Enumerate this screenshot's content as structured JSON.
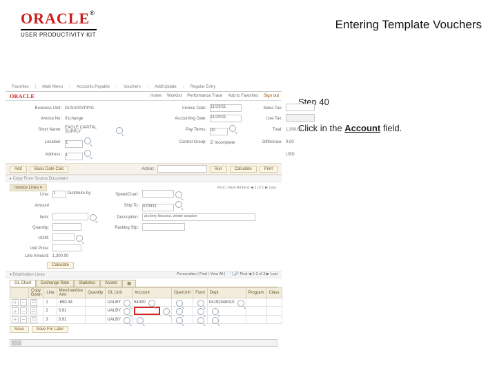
{
  "logo": {
    "brand": "ORACLE",
    "reg": "®",
    "sub": "USER PRODUCTIVITY KIT"
  },
  "doc_title": "Entering Template Vouchers",
  "step": {
    "label": "Step 40",
    "pre": "Click in the ",
    "field": "Account",
    "post": " field."
  },
  "shot": {
    "breadcrumb": {
      "i0": "Favorites",
      "i1": "Main Menu",
      "i2": "Accounts Payable",
      "i3": "Vouchers",
      "i4": "Add/Update",
      "i5": "Regular Entry"
    },
    "toplinks": {
      "home": "Home",
      "worklist": "Worklist",
      "pt": "Performance Trace",
      "atf": "Add to Favorites",
      "signout": "Sign out"
    },
    "brand_small": "ORACLE",
    "hdr": {
      "l_unit": "Business Unit:",
      "v_unit": "DUSAPAYPP01",
      "l_invno": "Invoice No:",
      "v_invno": "01change",
      "l_invdt": "Invoice Date:",
      "v_invdt": "11/29/11",
      "l_ctrl": "Control Group:",
      "l_acct": "Accounting Date:",
      "v_acct": "11/29/11",
      "l_short": "Short Name:",
      "v_short": "EAGLE CAPITAL SUPPLY",
      "l_loc": "Location:",
      "v_loc": "1",
      "l_addr": "Address:",
      "v_addr": "1",
      "l_incmp_chk": "Incomplete",
      "incmp_checked": "☑",
      "l_pay": "Pay Terms:",
      "v_pay": "00",
      "l_sales": "Sales Tax:",
      "l_use": "Use Tax:",
      "l_total": "Total:",
      "v_total": "1,300.00",
      "l_diff": "Difference:",
      "v_diff": "0.00",
      "v_curr": "USD"
    },
    "btns": {
      "add": "Add",
      "basis": "Basis Date Calc",
      "action_lbl": "Action:",
      "run": "Run",
      "calc": "Calculate",
      "prn": "Print"
    },
    "chev": "▸  Copy From Source Document",
    "inv_tab": "Invoice Lines ▾",
    "pcright": "Find | View All    First ◀ 1 of 1 ▶ Last",
    "inv": {
      "l_line": "Line:",
      "v_line": "1",
      "l_dist": "Distribute by:",
      "v_dist": "Amount",
      "l_item": "Item:",
      "l_qty": "Quantity:",
      "l_uom": "UOM:",
      "l_price": "Unit Price:",
      "l_amt": "Line Amount:",
      "v_amt": "1,300.00",
      "l_speed": "SpeedChart:",
      "l_shipto": "Ship To:",
      "v_shipto": "020931",
      "l_desc": "Description:",
      "v_desc": "archery lessons, winter session",
      "l_pack": "Packing Slip:",
      "calc_btn": "Calculate"
    },
    "pcright2": "Personalize | Find | View All | 📄 | 🔎    First ◀ 1-3 of 3 ▶ Last",
    "dist_bar": "▾ Distribution Lines",
    "dtabs": {
      "gl": "GL Chart",
      "ex": "Exchange Rate",
      "st": "Statistics",
      "as": "Assets",
      "more": "▦"
    },
    "grid": {
      "h_copy": "Copy Down",
      "h_line": "Line",
      "h_merch": "Merchandise Amt",
      "h_qty": "Quantity",
      "h_glunit": "GL Unit",
      "h_acct": "Account",
      "h_oper": "OperUnit",
      "h_fund": "Fund",
      "h_dept": "Dept",
      "h_prog": "Program",
      "h_cls": "Class",
      "r1": {
        "pm": "＋ －",
        "cd": "☐",
        "line": "1",
        "amt": "-650.34",
        "glu": "UALBY",
        "acct": "54000",
        "oper": "",
        "fund": "",
        "dept": "04192048010"
      },
      "r2": {
        "pm": "＋ －",
        "cd": "☐",
        "line": "2",
        "amt": "3.91",
        "glu": "UALBY",
        "acct": "",
        "oper": "",
        "fund": "",
        "dept": ""
      },
      "r3": {
        "pm": "＋ －",
        "cd": "☐",
        "line": "3",
        "amt": "3.91",
        "glu": "UALBY",
        "acct": "",
        "oper": "",
        "fund": "",
        "dept": ""
      }
    },
    "foot": {
      "save": "Save",
      "sfl": "Save For Later"
    }
  }
}
